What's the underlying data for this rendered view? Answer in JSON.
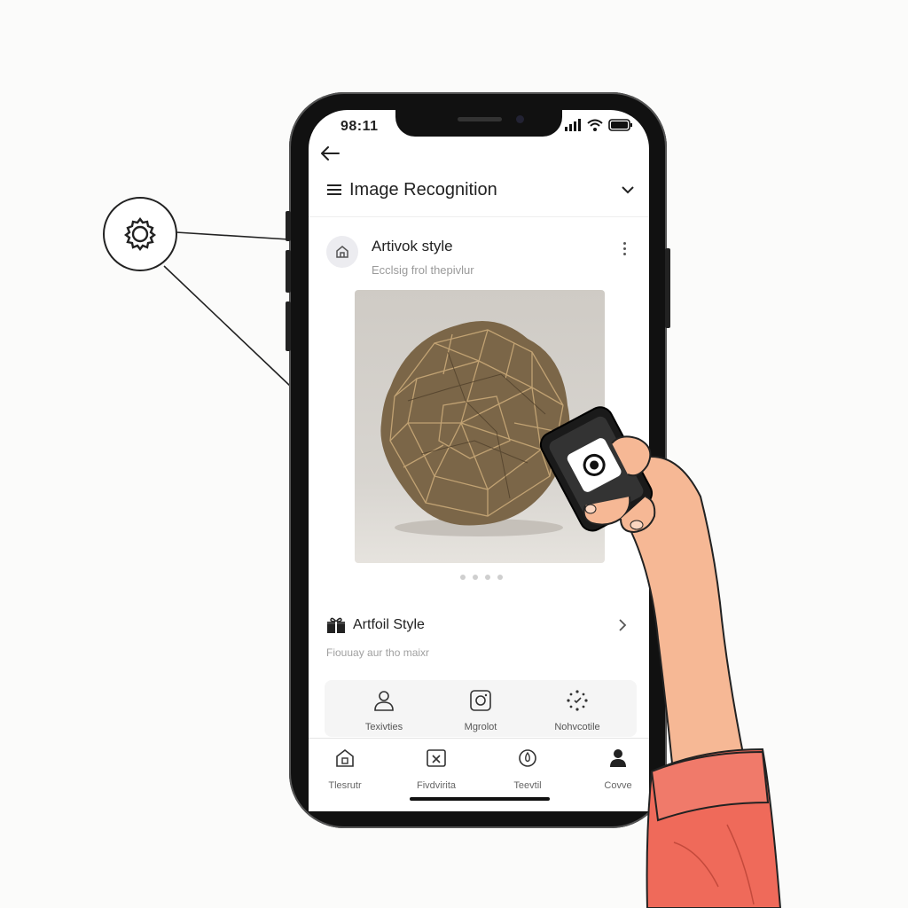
{
  "status_bar": {
    "time": "98:11"
  },
  "app_bar": {
    "title": "Image Recognition"
  },
  "result_card": {
    "title": "Artivok style",
    "subtitle": "Ecclsig frol thepivlur",
    "carousel_pages": 4
  },
  "style_section": {
    "title": "Artfoil Style",
    "subtitle": "Fiouuay aur tho maixr"
  },
  "actions": [
    {
      "label": "Texivties",
      "icon": "person-icon"
    },
    {
      "label": "Mgrolot",
      "icon": "camera-icon"
    },
    {
      "label": "Nohvcotile",
      "icon": "sparkle-icon"
    }
  ],
  "tabs": [
    {
      "label": "Tlesrutr",
      "icon": "home-icon"
    },
    {
      "label": "Fivdvirita",
      "icon": "image-x-icon"
    },
    {
      "label": "Teevtil",
      "icon": "badge-icon"
    },
    {
      "label": "Covve",
      "icon": "profile-icon"
    }
  ],
  "colors": {
    "sleeve": "#ef6a5a",
    "skin": "#f6b895",
    "accent": "#222222"
  }
}
